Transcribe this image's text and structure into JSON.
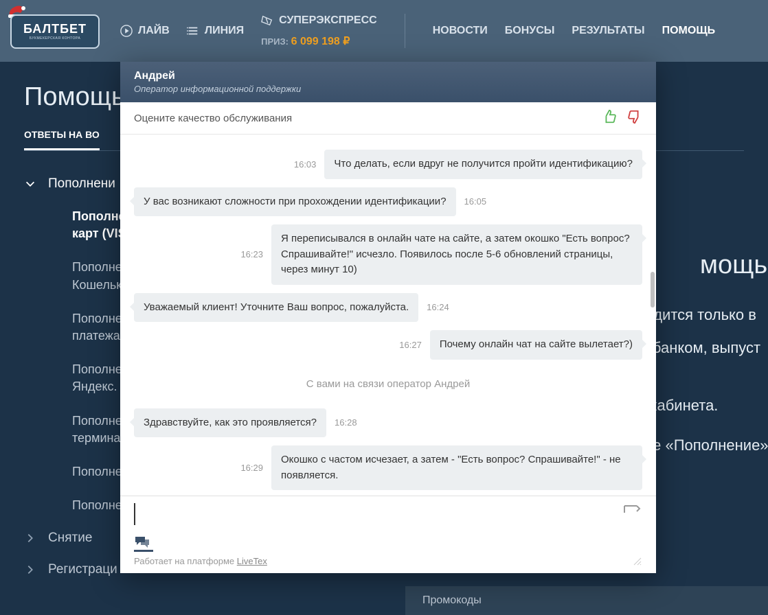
{
  "logo": {
    "text": "БАЛТБЕТ",
    "sub": "БУКМЕКЕРСКАЯ КОНТОРА"
  },
  "nav": {
    "left": [
      {
        "label": "ЛАЙВ",
        "icon": "play"
      },
      {
        "label": "ЛИНИЯ",
        "icon": "list"
      },
      {
        "label": "СУПЕРЭКСПРЕСС",
        "icon": "ticket",
        "prize_label": "ПРИЗ:",
        "prize_value": "6 099 198 ₽"
      }
    ],
    "right": [
      {
        "label": "НОВОСТИ"
      },
      {
        "label": "БОНУСЫ"
      },
      {
        "label": "РЕЗУЛЬТАТЫ"
      },
      {
        "label": "ПОМОЩЬ",
        "active": true
      }
    ]
  },
  "page": {
    "title": "Помощь",
    "tab": "ОТВЕТЫ НА ВО"
  },
  "sidebar": {
    "groups": [
      {
        "label": "Пополнени",
        "expanded": true,
        "items": [
          {
            "label": "Пополнение счёта с помощью банковских карт (VIS",
            "active": true
          },
          {
            "label": "Пополнение Кошельк"
          },
          {
            "label": "Пополнение платежа"
          },
          {
            "label": "Пополнение Яндекс."
          },
          {
            "label": "Пополнение термина"
          },
          {
            "label": "Пополне"
          },
          {
            "label": "Пополне"
          }
        ]
      },
      {
        "label": "Снятие",
        "expanded": false
      },
      {
        "label": "Регистраци",
        "expanded": false
      }
    ]
  },
  "bg": {
    "title": "мощью б",
    "lines": [
      "водится только в",
      "ы банком, выпуст",
      "о кабинета.",
      "ите «Пополнение»"
    ]
  },
  "promo": {
    "label": "Промокоды"
  },
  "chat": {
    "agent": "Андрей",
    "role": "Оператор информационной поддержки",
    "rate_prompt": "Оцените качество обслуживания",
    "system": "С вами на связи оператор Андрей",
    "messages": [
      {
        "side": "right",
        "time": "16:03",
        "text": "Что делать, если вдруг не получится пройти идентификацию?"
      },
      {
        "side": "left",
        "time": "16:05",
        "text": "У вас возникают сложности при прохождении идентификации?"
      },
      {
        "side": "right",
        "time": "16:23",
        "text": "Я переписывался в онлайн чате на сайте, а затем окошко \"Есть вопрос? Спрашивайте!\" исчезло. Появилось после 5-6 обновлений страницы, через минут 10)"
      },
      {
        "side": "left",
        "time": "16:24",
        "text": "Уважаемый клиент! Уточните Ваш вопрос, пожалуйста."
      },
      {
        "side": "right",
        "time": "16:27",
        "text": "Почему онлайн чат на сайте вылетает?)"
      },
      {
        "side": "system",
        "text": "С вами на связи оператор Андрей"
      },
      {
        "side": "left",
        "time": "16:28",
        "text": "Здравствуйте, как это проявляется?"
      },
      {
        "side": "right",
        "time": "16:29",
        "text": "Окошко с частом исчезает, а затем - \"Есть вопрос? Спрашивайте!\" - не появляется."
      }
    ],
    "footer_prefix": "Работает на платформе ",
    "footer_link": "LiveTex"
  }
}
